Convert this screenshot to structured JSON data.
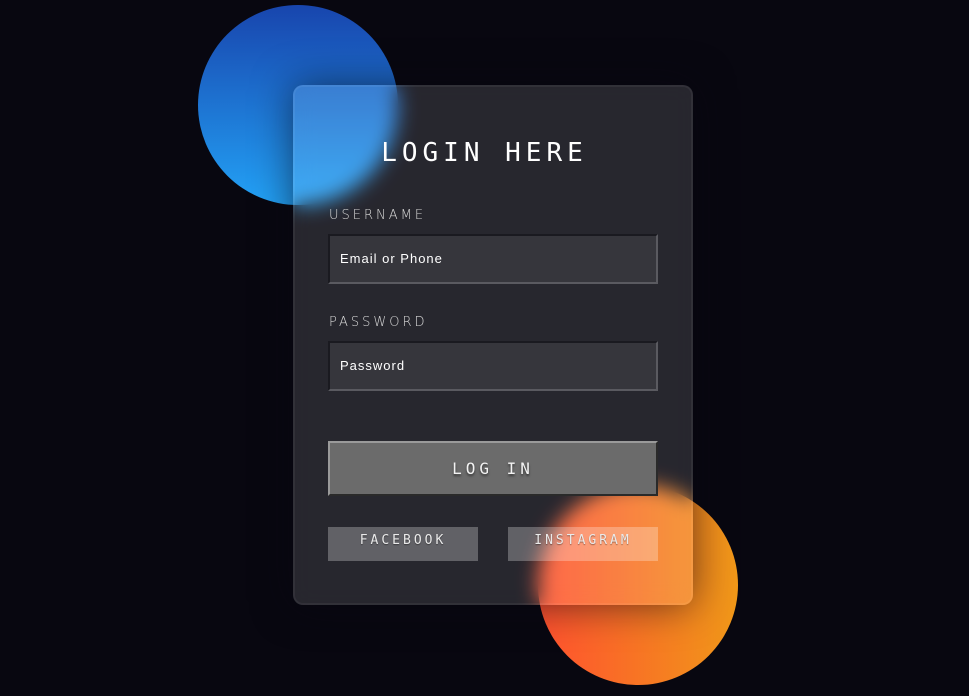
{
  "form": {
    "title": "LOGIN HERE",
    "username_label": "USERNAME",
    "username_placeholder": "Email or Phone",
    "password_label": "PASSWORD",
    "password_placeholder": "Password",
    "login_label": "LOG IN"
  },
  "social": {
    "facebook_label": "FACEBOOK",
    "instagram_label": "INSTAGRAM"
  },
  "colors": {
    "background": "#080710",
    "blue_gradient": [
      "#1845ad",
      "#23a2f6"
    ],
    "orange_gradient": [
      "#ff512f",
      "#f09819"
    ]
  }
}
